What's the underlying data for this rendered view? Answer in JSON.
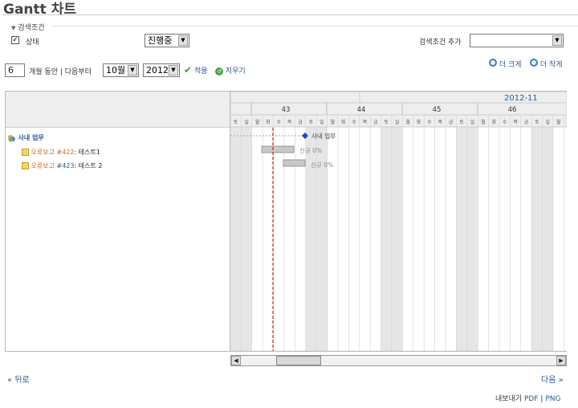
{
  "page": {
    "title": "Gantt 차트"
  },
  "filters": {
    "legend": "검색조건",
    "status_label": "상태",
    "status_checked": true,
    "status_value": "진행중",
    "add_filter_label": "검색조건 추가",
    "add_filter_value": ""
  },
  "period": {
    "months": "6",
    "months_label": "개월 동안 | 다음부터",
    "month": "10월",
    "year": "2012",
    "apply_label": "적용",
    "clear_label": "지우기"
  },
  "zoom": {
    "zoom_in_label": "더 크게",
    "zoom_out_label": "더 작게"
  },
  "gantt": {
    "month_label": "2012-11",
    "weeks": [
      "43",
      "44",
      "45",
      "46"
    ],
    "day_letters": [
      "토",
      "일",
      "월",
      "화",
      "수",
      "목",
      "금",
      "토",
      "일",
      "월",
      "화",
      "수",
      "목",
      "금",
      "토",
      "일",
      "월",
      "화",
      "수",
      "목",
      "금",
      "토",
      "일",
      "월",
      "화",
      "수",
      "목",
      "금",
      "토",
      "일",
      "월",
      "화"
    ],
    "project": {
      "name": "사내 업무"
    },
    "issues": [
      {
        "tracker": "오류보고",
        "number": "#422",
        "subject": "테스트1",
        "status": "신규 0%"
      },
      {
        "tracker": "오류보고",
        "number": "#423",
        "subject": "테스트 2",
        "status": "신규 0%"
      }
    ]
  },
  "nav": {
    "prev_label": "« 뒤로",
    "next_label": "다음 »"
  },
  "export": {
    "label": "내보내기",
    "pdf_label": "PDF",
    "separator": "|",
    "png_label": "PNG"
  },
  "colors": {
    "link": "#2a5a9a",
    "tracker": "#d2691e",
    "today_line": "#cc0000",
    "weekend": "#e6e6e6"
  }
}
